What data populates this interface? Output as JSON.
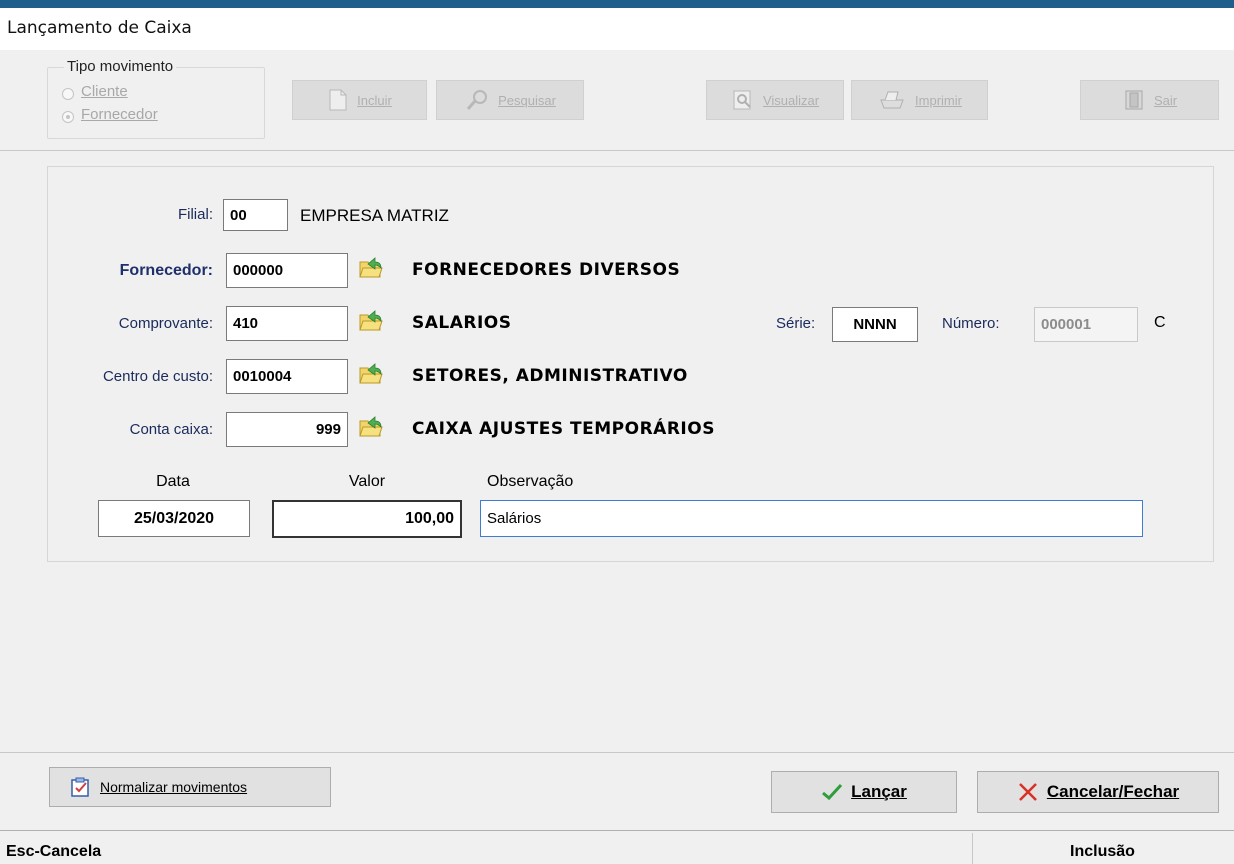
{
  "window": {
    "title": "Lançamento de Caixa"
  },
  "tipo_movimento": {
    "label": "Tipo movimento",
    "options": [
      {
        "label": "Cliente",
        "checked": false
      },
      {
        "label": "Fornecedor",
        "checked": true
      }
    ]
  },
  "toolbar": {
    "incluir": "Incluir",
    "pesquisar": "Pesquisar",
    "visualizar": "Visualizar",
    "imprimir": "Imprimir",
    "sair": "Sair"
  },
  "form": {
    "filial": {
      "label": "Filial:",
      "value": "00",
      "desc": "EMPRESA MATRIZ"
    },
    "fornecedor": {
      "label": "Fornecedor:",
      "value": "000000",
      "desc": "FORNECEDORES DIVERSOS"
    },
    "comprovante": {
      "label": "Comprovante:",
      "value": "410",
      "desc": "SALARIOS"
    },
    "serie": {
      "label": "Série:",
      "value": "NNNN"
    },
    "numero": {
      "label": "Número:",
      "value": "000001",
      "suffix": "C"
    },
    "centro_custo": {
      "label": "Centro de custo:",
      "value": "0010004",
      "desc": "SETORES, ADMINISTRATIVO"
    },
    "conta_caixa": {
      "label": "Conta caixa:",
      "value": "999",
      "desc": "CAIXA AJUSTES TEMPORÁRIOS"
    },
    "data": {
      "label": "Data",
      "value": "25/03/2020"
    },
    "valor": {
      "label": "Valor",
      "value": "100,00"
    },
    "observacao": {
      "label": "Observação",
      "value": "Salários"
    }
  },
  "bottom": {
    "normalizar": "Normalizar movimentos",
    "lancar": "Lançar",
    "cancelar": "Cancelar/Fechar"
  },
  "status": {
    "left": "Esc-Cancela",
    "right": "Inclusão"
  },
  "colors": {
    "accent": "#1f5f8b",
    "label_blue": "#1f2f6b",
    "folder_green": "#4caf50",
    "cancel_red": "#d93025",
    "check_green": "#2e9d3a"
  },
  "icons": [
    "document-icon",
    "search-icon",
    "preview-icon",
    "printer-icon",
    "exit-door-icon",
    "folder-open-icon",
    "checklist-icon",
    "check-icon",
    "close-x-icon"
  ]
}
